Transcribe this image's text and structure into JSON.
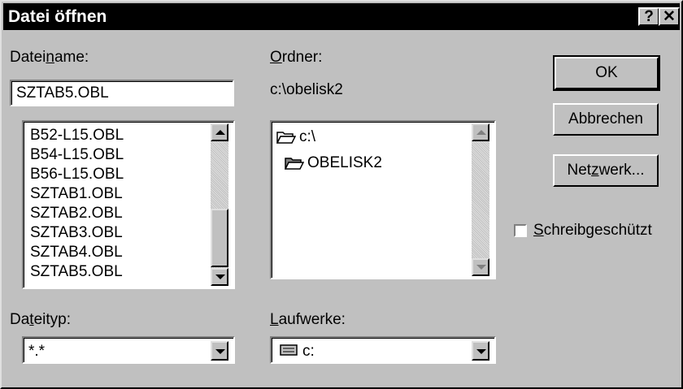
{
  "titlebar": {
    "title": "Datei öffnen",
    "help_label": "?",
    "close_label": "✕"
  },
  "filename": {
    "label_pre": "Datei",
    "label_mnemonic": "n",
    "label_post": "ame:",
    "value": "SZTAB5.OBL",
    "files": [
      "B52-L15.OBL",
      "B54-L15.OBL",
      "B56-L15.OBL",
      "SZTAB1.OBL",
      "SZTAB2.OBL",
      "SZTAB3.OBL",
      "SZTAB4.OBL",
      "SZTAB5.OBL"
    ]
  },
  "folder": {
    "label_mnemonic": "O",
    "label_post": "rdner:",
    "current_path": "c:\\obelisk2",
    "items": [
      "c:\\",
      "OBELISK2"
    ]
  },
  "filetype": {
    "label_pre": "Da",
    "label_mnemonic": "t",
    "label_post": "eityp:",
    "value": "*.*"
  },
  "drives": {
    "label_mnemonic": "L",
    "label_post": "aufwerke:",
    "value": "c:"
  },
  "buttons": {
    "ok": "OK",
    "cancel": "Abbrechen",
    "network_pre": "Net",
    "network_mnemonic": "z",
    "network_post": "werk..."
  },
  "readonly": {
    "label_mnemonic": "S",
    "label_post": "chreibgeschützt",
    "checked": false
  }
}
